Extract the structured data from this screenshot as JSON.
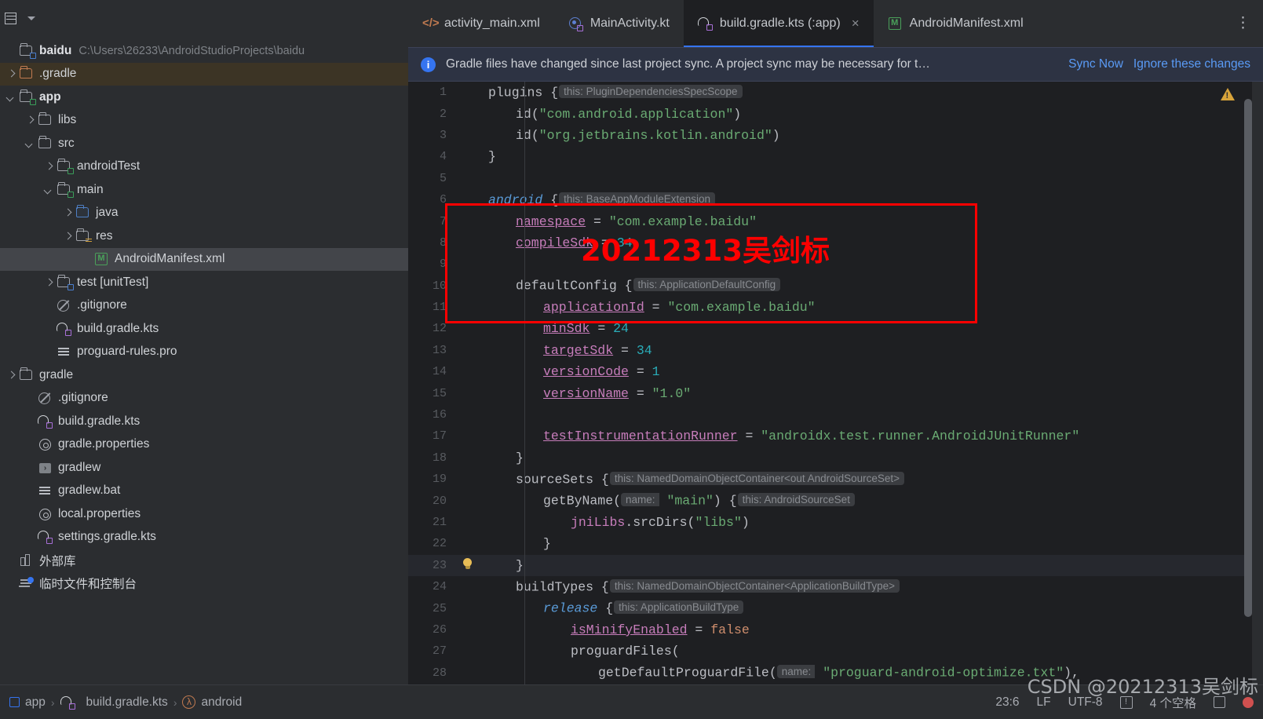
{
  "sidebar": {
    "header": {
      "icon": "project-grid-icon",
      "chevron": "chevron-down-icon"
    },
    "project": {
      "name": "baidu",
      "path": "C:\\Users\\26233\\AndroidStudioProjects\\baidu",
      "icon": "module-folder-icon"
    },
    "items": [
      {
        "label": ".gradle",
        "indent": 0,
        "arrow": "right",
        "icon": "folder-orange-icon",
        "state": "highlighted"
      },
      {
        "label": "app",
        "indent": 0,
        "arrow": "down",
        "icon": "module-folder-green-icon",
        "bold": true
      },
      {
        "label": "libs",
        "indent": 1,
        "arrow": "right",
        "icon": "folder-icon"
      },
      {
        "label": "src",
        "indent": 1,
        "arrow": "down",
        "icon": "folder-icon"
      },
      {
        "label": "androidTest",
        "indent": 2,
        "arrow": "right",
        "icon": "module-folder-green-icon"
      },
      {
        "label": "main",
        "indent": 2,
        "arrow": "down",
        "icon": "module-folder-green-icon"
      },
      {
        "label": "java",
        "indent": 3,
        "arrow": "right",
        "icon": "folder-blue-icon"
      },
      {
        "label": "res",
        "indent": 3,
        "arrow": "right",
        "icon": "folder-res-icon"
      },
      {
        "label": "AndroidManifest.xml",
        "indent": 4,
        "arrow": "none",
        "icon": "manifest-icon",
        "state": "selected"
      },
      {
        "label": "test [unitTest]",
        "indent": 2,
        "arrow": "right",
        "icon": "module-folder-blue-icon"
      },
      {
        "label": ".gitignore",
        "indent": 2,
        "arrow": "none",
        "icon": "gitignore-icon"
      },
      {
        "label": "build.gradle.kts",
        "indent": 2,
        "arrow": "none",
        "icon": "gradle-kts-icon"
      },
      {
        "label": "proguard-rules.pro",
        "indent": 2,
        "arrow": "none",
        "icon": "text-lines-icon"
      },
      {
        "label": "gradle",
        "indent": 0,
        "arrow": "right",
        "icon": "folder-icon"
      },
      {
        "label": ".gitignore",
        "indent": 1,
        "arrow": "none",
        "icon": "gitignore-icon"
      },
      {
        "label": "build.gradle.kts",
        "indent": 1,
        "arrow": "none",
        "icon": "gradle-kts-icon"
      },
      {
        "label": "gradle.properties",
        "indent": 1,
        "arrow": "none",
        "icon": "gear-icon"
      },
      {
        "label": "gradlew",
        "indent": 1,
        "arrow": "none",
        "icon": "terminal-icon"
      },
      {
        "label": "gradlew.bat",
        "indent": 1,
        "arrow": "none",
        "icon": "text-lines-icon"
      },
      {
        "label": "local.properties",
        "indent": 1,
        "arrow": "none",
        "icon": "gear-icon"
      },
      {
        "label": "settings.gradle.kts",
        "indent": 1,
        "arrow": "none",
        "icon": "gradle-kts-icon"
      },
      {
        "label": "外部库",
        "indent": 0,
        "arrow": "none",
        "icon": "external-libraries-icon"
      },
      {
        "label": "临时文件和控制台",
        "indent": 0,
        "arrow": "none",
        "icon": "scratches-icon"
      }
    ]
  },
  "tabs": [
    {
      "label": "activity_main.xml",
      "icon": "xml-file-icon",
      "active": false,
      "closable": false
    },
    {
      "label": "MainActivity.kt",
      "icon": "kotlin-class-icon",
      "active": false,
      "closable": false
    },
    {
      "label": "build.gradle.kts (:app)",
      "icon": "gradle-kts-icon",
      "active": true,
      "closable": true,
      "close_label": "×"
    },
    {
      "label": "AndroidManifest.xml",
      "icon": "manifest-icon",
      "active": false,
      "closable": false
    }
  ],
  "tabs_overflow_icon": "more-options-icon",
  "sync_banner": {
    "icon": "info-icon",
    "icon_glyph": "i",
    "message": "Gradle files have changed since last project sync. A project sync may be necessary for t…",
    "sync_now": "Sync Now",
    "ignore": "Ignore these changes"
  },
  "editor": {
    "warning_icon": "warning-triangle-icon",
    "current_line": 23,
    "bulb_icon": "intention-bulb-icon",
    "lines": [
      {
        "n": 1,
        "indent": 0,
        "html": "<span class='ident'>plugins</span> {<span class='hint'>this: PluginDependenciesSpecScope</span>"
      },
      {
        "n": 2,
        "indent": 1,
        "html": "<span class='ident'>id</span>(<span class='str'>\"com.android.application\"</span>)"
      },
      {
        "n": 3,
        "indent": 1,
        "html": "<span class='ident'>id</span>(<span class='str'>\"org.jetbrains.kotlin.android\"</span>)"
      },
      {
        "n": 4,
        "indent": 0,
        "html": "}"
      },
      {
        "n": 5,
        "indent": 0,
        "html": ""
      },
      {
        "n": 6,
        "indent": 0,
        "html": "<span class='kwb'>android</span> {<span class='hint'>this: BaseAppModuleExtension</span>"
      },
      {
        "n": 7,
        "indent": 1,
        "html": "<span class='prop'>namespace</span> = <span class='str'>\"com.example.baidu\"</span>"
      },
      {
        "n": 8,
        "indent": 1,
        "html": "<span class='prop'>compileSdk</span> = <span class='num'>34</span>"
      },
      {
        "n": 9,
        "indent": 1,
        "html": ""
      },
      {
        "n": 10,
        "indent": 1,
        "html": "<span class='ident'>defaultConfig</span> {<span class='hint'>this: ApplicationDefaultConfig</span>"
      },
      {
        "n": 11,
        "indent": 2,
        "html": "<span class='prop'>applicationId</span> = <span class='str'>\"com.example.baidu\"</span>"
      },
      {
        "n": 12,
        "indent": 2,
        "html": "<span class='prop'>minSdk</span> = <span class='num'>24</span>"
      },
      {
        "n": 13,
        "indent": 2,
        "html": "<span class='prop'>targetSdk</span> = <span class='num'>34</span>"
      },
      {
        "n": 14,
        "indent": 2,
        "html": "<span class='prop'>versionCode</span> = <span class='num'>1</span>"
      },
      {
        "n": 15,
        "indent": 2,
        "html": "<span class='prop'>versionName</span> = <span class='str'>\"1.0\"</span>"
      },
      {
        "n": 16,
        "indent": 2,
        "html": ""
      },
      {
        "n": 17,
        "indent": 2,
        "html": "<span class='prop'>testInstrumentationRunner</span> = <span class='str'>\"androidx.test.runner.AndroidJUnitRunner\"</span>"
      },
      {
        "n": 18,
        "indent": 1,
        "html": "}"
      },
      {
        "n": 19,
        "indent": 1,
        "html": "<span class='ident'>sourceSets</span> {<span class='hint'>this: NamedDomainObjectContainer&lt;out AndroidSourceSet&gt;</span>"
      },
      {
        "n": 20,
        "indent": 2,
        "html": "<span class='ident'>getByName</span>(<span class='hint-i'>name:</span> <span class='str'>\"main\"</span>) {<span class='hint'>this: AndroidSourceSet</span>"
      },
      {
        "n": 21,
        "indent": 3,
        "html": "<span class='pink'>jniLibs</span>.<span class='ident'>srcDirs</span>(<span class='str'>\"libs\"</span>)"
      },
      {
        "n": 22,
        "indent": 2,
        "html": "}"
      },
      {
        "n": 23,
        "indent": 1,
        "html": "}"
      },
      {
        "n": 24,
        "indent": 1,
        "html": "<span class='ident'>buildTypes</span> {<span class='hint'>this: NamedDomainObjectContainer&lt;ApplicationBuildType&gt;</span>"
      },
      {
        "n": 25,
        "indent": 2,
        "html": "<span class='kwb'>release</span> {<span class='hint'>this: ApplicationBuildType</span>"
      },
      {
        "n": 26,
        "indent": 3,
        "html": "<span class='prop'>isMinifyEnabled</span> = <span class='kw'>false</span>"
      },
      {
        "n": 27,
        "indent": 3,
        "html": "<span class='ident'>proguardFiles</span>("
      },
      {
        "n": 28,
        "indent": 4,
        "html": "<span class='ident'>getDefaultProguardFile</span>(<span class='hint-i'>name:</span> <span class='str'>\"proguard-android-optimize.txt\"</span>),"
      }
    ]
  },
  "annotations": {
    "red_box_label": "sourceSets-highlight-box",
    "red_watermark": "20212313吴剑标",
    "csdn_watermark": "CSDN @20212313吴剑标"
  },
  "statusbar": {
    "breadcrumb": [
      {
        "label": "app",
        "icon": "module-square-icon"
      },
      {
        "label": "build.gradle.kts",
        "icon": "gradle-kts-icon"
      },
      {
        "label": "android",
        "icon": "lambda-icon"
      }
    ],
    "separator": "›",
    "caret": "23:6",
    "line_separator": "LF",
    "encoding": "UTF-8",
    "indent": "4 个空格",
    "warnings_icon": "inspection-icon",
    "lock_icon": "readonly-lock-icon",
    "notification_icon": "notification-dot-icon"
  },
  "colors": {
    "accent_blue": "#3574f0",
    "annotation_red": "#fe0000",
    "editor_bg": "#1e1f22",
    "panel_bg": "#2b2d30",
    "string_green": "#6aab73",
    "number_cyan": "#2aacb8",
    "property_pink": "#c77dbb",
    "keyword_orange": "#cf8e6d"
  }
}
